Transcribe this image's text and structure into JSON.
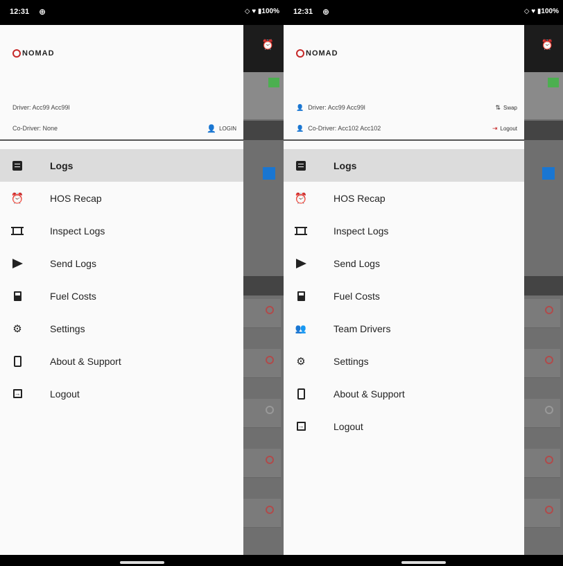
{
  "left": {
    "status": {
      "time": "12:31",
      "extra": "⊕",
      "icons": "◇ ♥ ▮100%"
    },
    "logo": "NOMAD",
    "driver": {
      "text": "Driver: Acc99 Acc99l"
    },
    "codriver": {
      "text": "Co-Driver: None",
      "action": "LOGIN"
    },
    "menu": [
      {
        "label": "Logs",
        "icon": "logs-icon",
        "active": true
      },
      {
        "label": "HOS Recap",
        "icon": "alarm-clock-icon"
      },
      {
        "label": "Inspect Logs",
        "icon": "inspect-icon"
      },
      {
        "label": "Send Logs",
        "icon": "send-icon"
      },
      {
        "label": "Fuel Costs",
        "icon": "fuel-icon"
      },
      {
        "label": "Settings",
        "icon": "gear-icon"
      },
      {
        "label": "About & Support",
        "icon": "phone-icon"
      },
      {
        "label": "Logout",
        "icon": "logout-icon"
      }
    ]
  },
  "right": {
    "status": {
      "time": "12:31",
      "extra": "⊕",
      "icons": "◇ ♥ ▮100%"
    },
    "logo": "NOMAD",
    "driver": {
      "text": "Driver: Acc99 Acc99l",
      "action": "Swap"
    },
    "codriver": {
      "text": "Co-Driver: Acc102 Acc102",
      "action": "Logout"
    },
    "menu": [
      {
        "label": "Logs",
        "icon": "logs-icon",
        "active": true
      },
      {
        "label": "HOS Recap",
        "icon": "alarm-clock-icon"
      },
      {
        "label": "Inspect Logs",
        "icon": "inspect-icon"
      },
      {
        "label": "Send Logs",
        "icon": "send-icon"
      },
      {
        "label": "Fuel Costs",
        "icon": "fuel-icon"
      },
      {
        "label": "Team Drivers",
        "icon": "team-icon"
      },
      {
        "label": "Settings",
        "icon": "gear-icon"
      },
      {
        "label": "About & Support",
        "icon": "phone-icon"
      },
      {
        "label": "Logout",
        "icon": "logout-icon"
      }
    ]
  },
  "colors": {
    "brand_red": "#c62828",
    "active_bg": "#dcdcdc",
    "codriver_green": "#43a047"
  }
}
